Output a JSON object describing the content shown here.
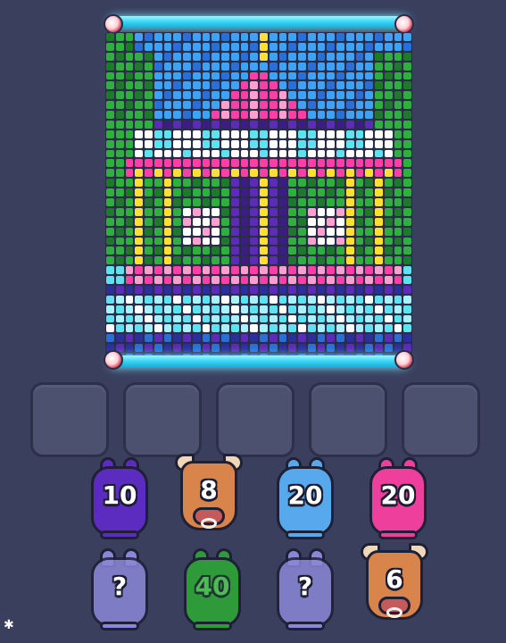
{
  "board": {
    "colors": {
      "blue": "#3ea3f6",
      "dblue": "#2a6fd8",
      "green": "#2fb03e",
      "dgreen": "#1c7a2a",
      "purple": "#5c2bb7",
      "dpurple": "#3e1c86",
      "pink": "#ff3fa6",
      "lpink": "#ff9fd0",
      "white": "#ffffff",
      "yellow": "#ffe02e",
      "cyan": "#5de2f0",
      "lcyan": "#a8f2ff",
      "navy": "#2b2f9c"
    }
  },
  "slots": {
    "count": 5
  },
  "units": [
    {
      "label": "10",
      "kind": "blob",
      "color": "#5c2bc0"
    },
    {
      "label": "8",
      "kind": "bull",
      "color": "#d9844a"
    },
    {
      "label": "20",
      "kind": "blob",
      "color": "#58a8ee"
    },
    {
      "label": "20",
      "kind": "blob",
      "color": "#ee3f9c"
    },
    {
      "label": "?",
      "kind": "ghost",
      "color": "#8b87d8"
    },
    {
      "label": "40",
      "kind": "blob-muted",
      "color": "#2f9a3a"
    },
    {
      "label": "?",
      "kind": "ghost",
      "color": "#8b87d8"
    },
    {
      "label": "6",
      "kind": "bull",
      "color": "#d9844a"
    }
  ],
  "corner_icon": "gear-icon"
}
